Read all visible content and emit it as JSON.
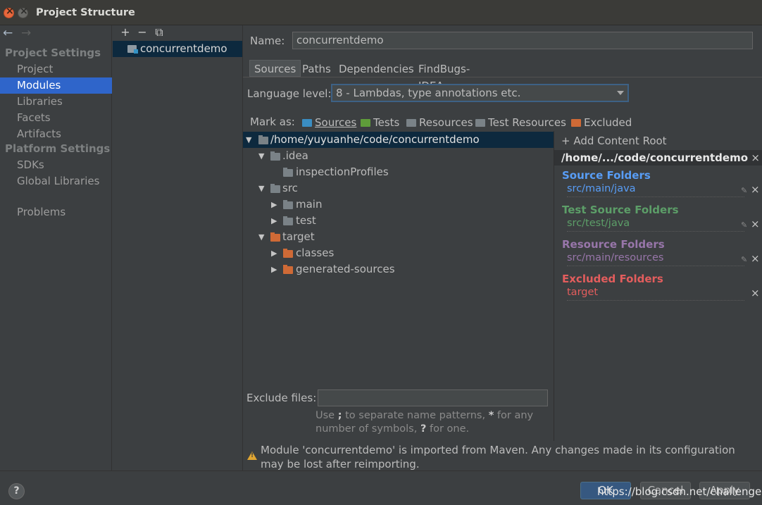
{
  "window": {
    "title": "Project Structure"
  },
  "nav": {
    "back": "←",
    "forward": "→",
    "sections": [
      {
        "label": "Project Settings"
      },
      {
        "label": "Platform Settings"
      }
    ],
    "items": [
      {
        "label": "Project"
      },
      {
        "label": "Modules"
      },
      {
        "label": "Libraries"
      },
      {
        "label": "Facets"
      },
      {
        "label": "Artifacts"
      },
      {
        "label": "SDKs"
      },
      {
        "label": "Global Libraries"
      },
      {
        "label": "Problems"
      }
    ]
  },
  "modules": {
    "toolbar": {
      "add": "+",
      "remove": "−",
      "copy": "⧉"
    },
    "items": [
      {
        "label": "concurrentdemo"
      }
    ]
  },
  "name": {
    "label": "Name:",
    "value": "concurrentdemo"
  },
  "tabs": [
    {
      "label": "Sources"
    },
    {
      "label": "Paths"
    },
    {
      "label": "Dependencies"
    },
    {
      "label": "FindBugs-IDEA"
    }
  ],
  "language": {
    "label": "Language level:",
    "value": "8 - Lambdas, type annotations etc."
  },
  "mark_as": {
    "label": "Mark as:",
    "items": [
      {
        "label": "Sources",
        "color": "#3a8dc2"
      },
      {
        "label": "Tests",
        "color": "#5f9d3a"
      },
      {
        "label": "Resources",
        "color": "#8f8f8f"
      },
      {
        "label": "Test Resources",
        "color": "#8f8f8f"
      },
      {
        "label": "Excluded",
        "color": "#cf6a36"
      }
    ]
  },
  "tree": [
    {
      "label": "/home/yuyuanhe/code/concurrentdemo",
      "expanded": true,
      "selected": true
    },
    {
      "label": ".idea",
      "expanded": true
    },
    {
      "label": "inspectionProfiles"
    },
    {
      "label": "src",
      "expanded": true
    },
    {
      "label": "main",
      "expanded": false
    },
    {
      "label": "test",
      "expanded": false
    },
    {
      "label": "target",
      "expanded": true
    },
    {
      "label": "classes",
      "expanded": false
    },
    {
      "label": "generated-sources",
      "expanded": false
    }
  ],
  "exclude": {
    "label": "Exclude files:",
    "value": "",
    "hint_a": "Use ",
    "hint_b": ";",
    "hint_c": " to separate name patterns, ",
    "hint_d": "*",
    "hint_e": " for any number of symbols, ",
    "hint_f": "?",
    "hint_g": " for one."
  },
  "content_root": {
    "add_label": "+ Add Content Root",
    "path": "/home/.../code/concurrentdemo",
    "close": "×",
    "sections": [
      {
        "title": "Source Folders",
        "item": "src/main/java",
        "color": "#589df6"
      },
      {
        "title": "Test Source Folders",
        "item": "src/test/java",
        "color": "#5c9e68"
      },
      {
        "title": "Resource Folders",
        "item": "src/main/resources",
        "color": "#9876aa"
      },
      {
        "title": "Excluded Folders",
        "item": "target",
        "color": "#e35d5d"
      }
    ]
  },
  "warning": {
    "text": "Module 'concurrentdemo' is imported from Maven. Any changes made in its configuration may be lost after reimporting."
  },
  "buttons": {
    "help": "?",
    "ok": "OK",
    "cancel": "Cancel",
    "apply": "Apply"
  },
  "watermark": "https://blog.csdn.net/challenge"
}
